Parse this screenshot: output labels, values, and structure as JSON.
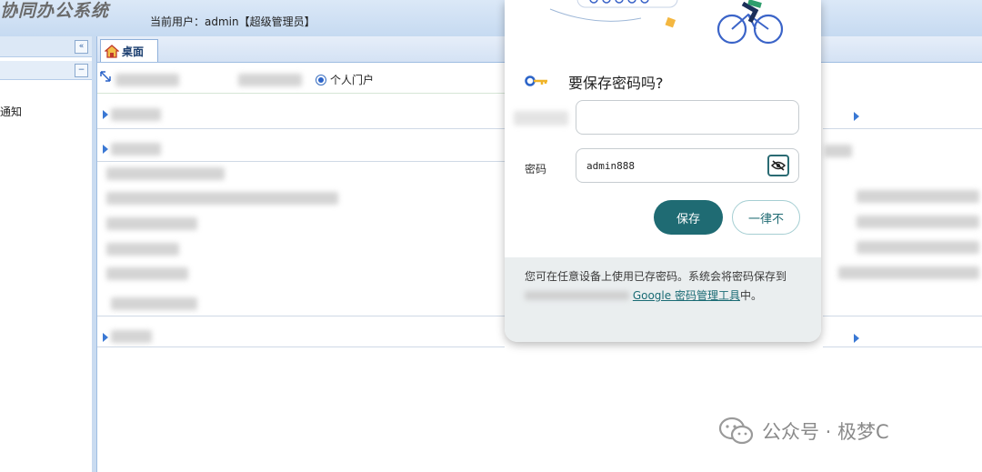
{
  "header": {
    "app_title": "协同办公系统",
    "current_user": "当前用户：admin【超级管理员】"
  },
  "sidebar": {
    "collapse_glyph": "«",
    "minus_glyph": "−",
    "notice_label": "通知"
  },
  "tabs": [
    {
      "label": "桌面",
      "icon": "home-icon"
    }
  ],
  "portal": {
    "radio_label": "个人门户"
  },
  "popup": {
    "title": "要保存密码吗?",
    "password_label": "密码",
    "password_value": "admin888",
    "save_label": "保存",
    "never_label": "一律不",
    "footer_prefix": "您可在任意设备上使用已存密码。系统会将密码保存到",
    "footer_link": "Google 密码管理工具",
    "footer_suffix": "中。",
    "accent_color": "#1f6b73"
  },
  "watermark": {
    "text": "公众号 · 极梦C"
  }
}
